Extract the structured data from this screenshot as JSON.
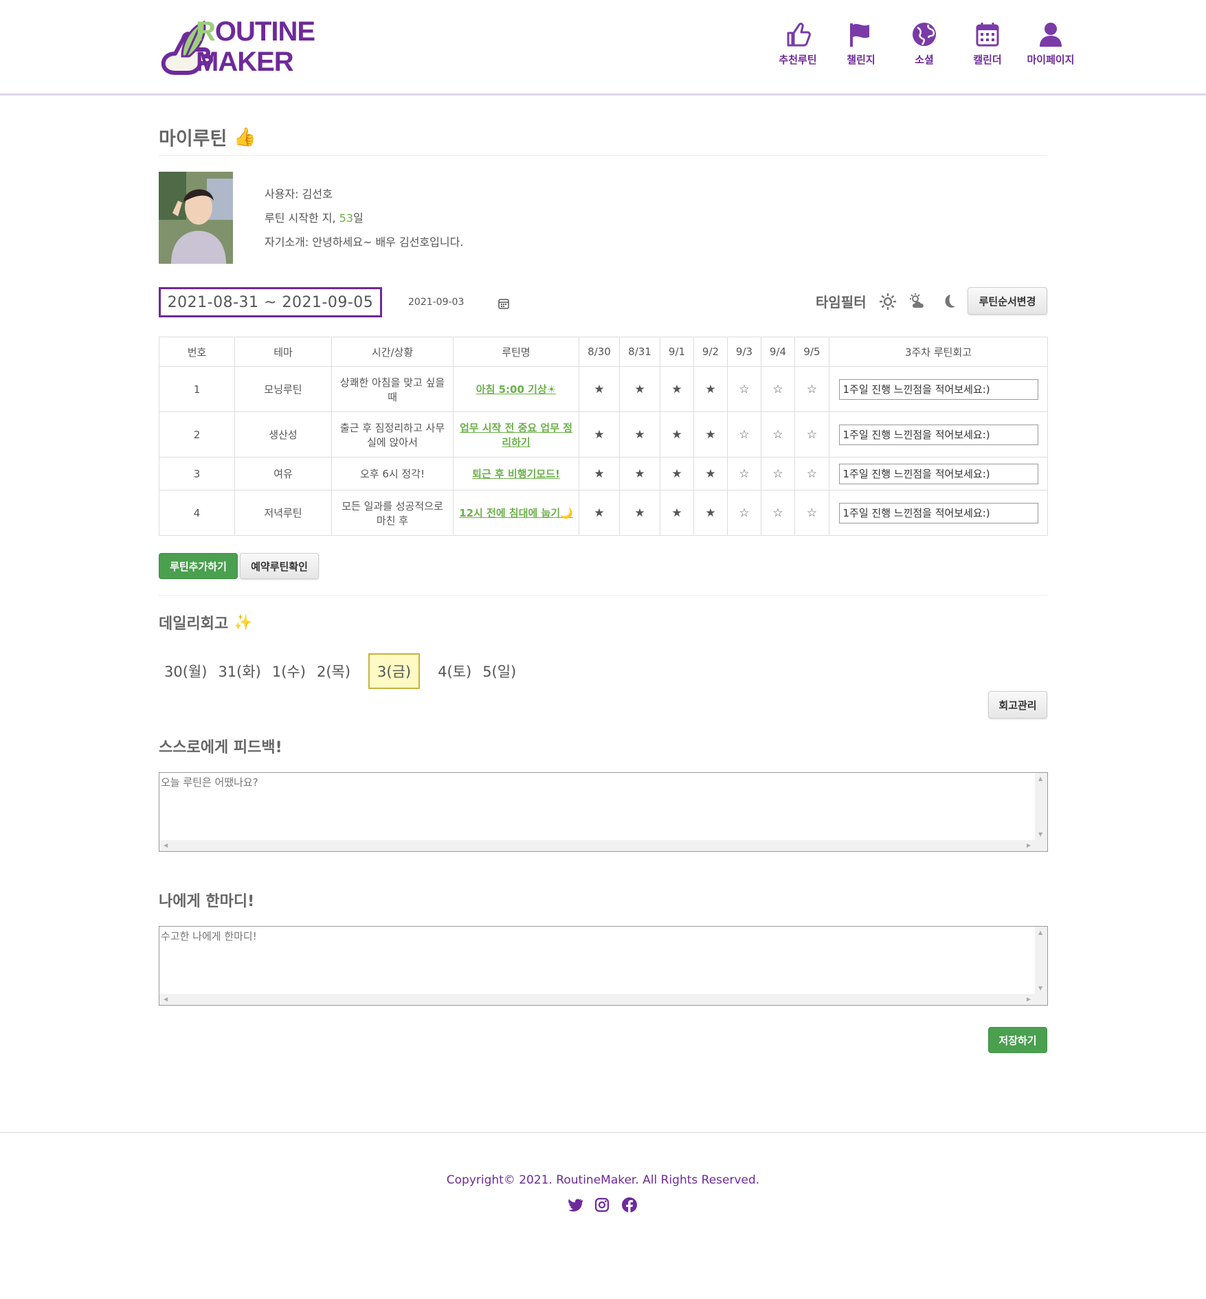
{
  "brand": {
    "line1_first": "R",
    "line1_rest": "OUTINE",
    "line2": "MAKER"
  },
  "nav": [
    {
      "label": "추천루틴",
      "icon": "thumbs-up-icon"
    },
    {
      "label": "챌린지",
      "icon": "flag-icon"
    },
    {
      "label": "소셜",
      "icon": "globe-icon"
    },
    {
      "label": "캘린더",
      "icon": "calendar-icon"
    },
    {
      "label": "마이페이지",
      "icon": "user-icon"
    }
  ],
  "page": {
    "title": "마이루틴",
    "title_emoji": "👍"
  },
  "profile": {
    "user_label": "사용자:",
    "user_name": "김선호",
    "days_label": "루틴 시작한 지,",
    "days_value": "53",
    "days_unit": "일",
    "intro_label": "자기소개:",
    "intro_text": "안녕하세요~ 배우 김선호입니다."
  },
  "controls": {
    "date_range": "2021-08-31 ~ 2021-09-05",
    "current_date": "2021-09-03",
    "time_filter_label": "타임필터",
    "reorder_button": "루틴순서변경",
    "add_button": "루틴추가하기",
    "reserved_button": "예약루틴확인"
  },
  "table": {
    "headers": [
      "번호",
      "테마",
      "시간/상황",
      "루틴명",
      "8/30",
      "8/31",
      "9/1",
      "9/2",
      "9/3",
      "9/4",
      "9/5",
      "3주차 루틴회고"
    ],
    "rows": [
      {
        "no": "1",
        "theme": "모닝루틴",
        "situation": "상쾌한 아침을 맞고 싶을 때",
        "name": "아침 5:00 기상☀",
        "stars": [
          "★",
          "★",
          "★",
          "★",
          "☆",
          "☆",
          "☆"
        ],
        "review": "1주일 진행 느낀점을 적어보세요:)"
      },
      {
        "no": "2",
        "theme": "생산성",
        "situation": "출근 후 짐정리하고 사무실에 앉아서",
        "name": "업무 시작 전 중요 업무 정리하기",
        "stars": [
          "★",
          "★",
          "★",
          "★",
          "☆",
          "☆",
          "☆"
        ],
        "review": "1주일 진행 느낀점을 적어보세요:)"
      },
      {
        "no": "3",
        "theme": "여유",
        "situation": "오후 6시 정각!",
        "name": "퇴근 후 비행기모드!",
        "stars": [
          "★",
          "★",
          "★",
          "★",
          "☆",
          "☆",
          "☆"
        ],
        "review": "1주일 진행 느낀점을 적어보세요:)"
      },
      {
        "no": "4",
        "theme": "저녁루틴",
        "situation": "모든 일과를 성공적으로 마친 후",
        "name": "12시 전에 침대에 눕기🌙",
        "stars": [
          "★",
          "★",
          "★",
          "★",
          "☆",
          "☆",
          "☆"
        ],
        "review": "1주일 진행 느낀점을 적어보세요:)"
      }
    ]
  },
  "daily": {
    "title": "데일리회고",
    "title_emoji": "✨",
    "days": [
      "30(월)",
      "31(화)",
      "1(수)",
      "2(목)",
      "3(금)",
      "4(토)",
      "5(일)"
    ],
    "active_day": "3(금)",
    "manage_button": "회고관리",
    "feedback_title": "스스로에게 피드백!",
    "feedback_placeholder": "오늘 루틴은 어땠나요?",
    "message_title": "나에게 한마디!",
    "message_placeholder": "수고한 나에게 한마디!",
    "save_button": "저장하기"
  },
  "footer": {
    "copyright": "Copyright© 2021. RoutineMaker. All Rights Reserved.",
    "social": [
      "twitter-icon",
      "instagram-icon",
      "facebook-icon"
    ]
  },
  "colors": {
    "brand_purple": "#6e2a9a",
    "accent_green": "#6bb04a",
    "button_green": "#4aa04f",
    "active_day_bg": "#fff9c4"
  }
}
